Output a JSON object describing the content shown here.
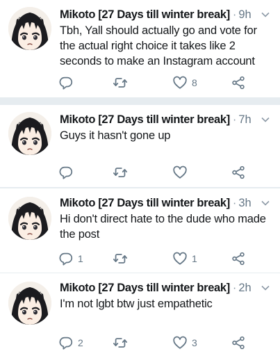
{
  "tweets": [
    {
      "name": "Mikoto [27 Days till winter break]",
      "time": "9h",
      "text": "Tbh, Yall should actually go and vote for the actual right choice it takes like 2 seconds to make an Instagram account",
      "replies": "",
      "retweets": "",
      "likes": "8"
    },
    {
      "name": "Mikoto [27 Days till winter break]",
      "time": "7h",
      "text": "Guys it hasn't gone up",
      "replies": "",
      "retweets": "",
      "likes": ""
    },
    {
      "name": "Mikoto [27 Days till winter break]",
      "time": "3h",
      "text": "Hi don't direct hate to the dude who made the post",
      "replies": "1",
      "retweets": "",
      "likes": "1"
    },
    {
      "name": "Mikoto [27 Days till winter break]",
      "time": "2h",
      "text": "I'm not lgbt btw just empathetic",
      "replies": "2",
      "retweets": "",
      "likes": "3"
    }
  ],
  "separator": "·",
  "icons": {
    "avatar": "anime-avatar-icon",
    "more": "chevron-down-icon",
    "reply": "reply-icon",
    "retweet": "retweet-icon",
    "like": "heart-icon",
    "share": "share-icon"
  },
  "colors": {
    "icon": "#657786",
    "background": "#ffffff",
    "divider": "#e6ecf0"
  }
}
